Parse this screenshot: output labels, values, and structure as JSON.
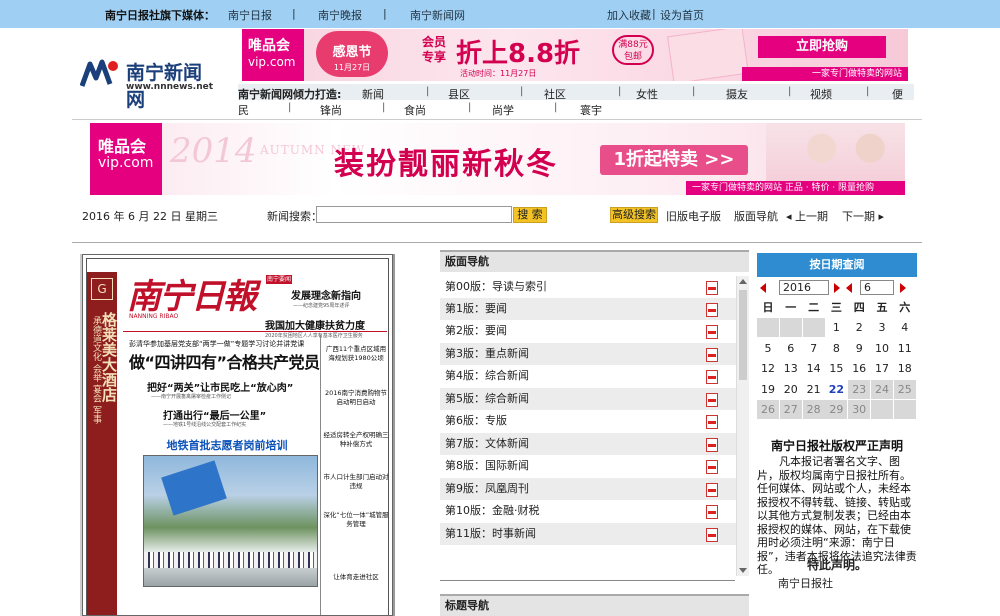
{
  "topbar": {
    "title": "南宁日报社旗下媒体：",
    "links": [
      "南宁日报",
      "南宁晚报",
      "南宁新闻网"
    ],
    "right_links": [
      "加入收藏",
      "设为首页"
    ]
  },
  "logo": {
    "name": "南宁新闻网",
    "url": "www.nnnews.net"
  },
  "top_ad": {
    "brand": "唯品会",
    "brand_url": "vip.com",
    "event": "感恩节",
    "event_date": "11月27日",
    "member": "会员专享",
    "discount": "折上8.8折",
    "badge": "满88元包邮",
    "time": "活动时间：11月27日",
    "cta": "立即抢购",
    "sub": "一家专门做特卖的网站"
  },
  "nav": {
    "lead": "南宁新闻网倾力打造:",
    "row1": [
      "新闻",
      "县区",
      "社区",
      "女性",
      "摄友",
      "视频",
      "便"
    ],
    "row2": [
      "民",
      "锋尚",
      "食尚",
      "尚学",
      "寰宇"
    ]
  },
  "ad2": {
    "brand": "唯品会",
    "brand_url": "vip.com",
    "year": "2014",
    "season": "AUTUMN NEW",
    "slogan": "装扮靓丽新秋冬",
    "cta": "1折起特卖 >>",
    "bottom": "一家专门做特卖的网站  正品 · 特价 · 限量抢购"
  },
  "toolbar": {
    "date": "2016 年 6 月 22 日  星期三",
    "search_label": "新闻搜索：",
    "search_value": "",
    "search_btn": "搜 索",
    "advanced_btn": "高级搜索",
    "links": [
      "旧版电子版",
      "版面导航",
      "◂ 上一期",
      "下一期 ▸"
    ]
  },
  "paper": {
    "sidebar_box": "G",
    "sidebar_small": "承德道文化  会举  宴会  军事",
    "sidebar_big": "格莱美大酒店",
    "masthead": "南宁日報",
    "masthead_sub": "NANNING RIBAO",
    "red_label": "南宁要闻",
    "right_t1": "发展理念新指向",
    "right_t2": "——纪念建党95周年述评",
    "right_t3": "我国加大健康扶贫力度",
    "right_t4": "2020年贫困地区人人享有基本医疗卫生服务",
    "kicker": "彭清华参加基层党支部“两学一做”专题学习讨论并讲党课",
    "headline": "做“四讲四有”合格共产党员",
    "sub1": "把好“两关”让市民吃上“放心肉”",
    "sub1s": "——南宁开展畜禽屠宰检疫工作侧记",
    "sub2": "打通出行“最后一公里”",
    "sub2s": "——地铁1号线沿线公交配套工作纪实",
    "blue_head": "地铁首批志愿者岗前培训",
    "side": [
      "广西11个重点区域用海规划获1980公顷",
      "2016南宁消费购物节启动明日启动",
      "经适房转全产权明确三种补偿方式",
      "市人口计生部门启动对违规",
      "深化“七位一体”城管服务管理",
      "让体育走进社区"
    ]
  },
  "board_nav": {
    "title": "版面导航",
    "items": [
      "第00版：导读与索引",
      "第1版：要闻",
      "第2版：要闻",
      "第3版：重点新闻",
      "第4版：综合新闻",
      "第5版：综合新闻",
      "第6版：专版",
      "第7版：文体新闻",
      "第8版：国际新闻",
      "第9版：凤凰周刊",
      "第10版：金融·财税",
      "第11版：时事新闻"
    ]
  },
  "title_nav": {
    "title": "标题导航"
  },
  "calendar": {
    "title": "按日期查阅",
    "year": "2016",
    "month": "6",
    "weekdays": [
      "日",
      "一",
      "二",
      "三",
      "四",
      "五",
      "六"
    ],
    "days": [
      [
        "",
        "",
        "",
        "1",
        "2",
        "3",
        "4"
      ],
      [
        "5",
        "6",
        "7",
        "8",
        "9",
        "10",
        "11"
      ],
      [
        "12",
        "13",
        "14",
        "15",
        "16",
        "17",
        "18"
      ],
      [
        "19",
        "20",
        "21",
        "22",
        "23",
        "24",
        "25"
      ],
      [
        "26",
        "27",
        "28",
        "29",
        "30",
        "",
        ""
      ]
    ],
    "today": "22"
  },
  "copyright": {
    "title": "南宁日报社版权严正声明",
    "body": "凡本报记者署名文字、图片，版权均属南宁日报社所有。任何媒体、网站或个人，未经本报授权不得转载、链接、转贴或以其他方式复制发表；已经由本报授权的媒体、网站，在下载使用时必须注明“来源：南宁日报”，违者本报将依法追究法律责任。",
    "end": "特此声明。",
    "sign": "南宁日报社"
  },
  "colors": {
    "vip_pink": "#e4007f",
    "topbar": "#9fd0f3",
    "calendar_head": "#2f8cd1",
    "button_yellow": "#f3c326"
  }
}
